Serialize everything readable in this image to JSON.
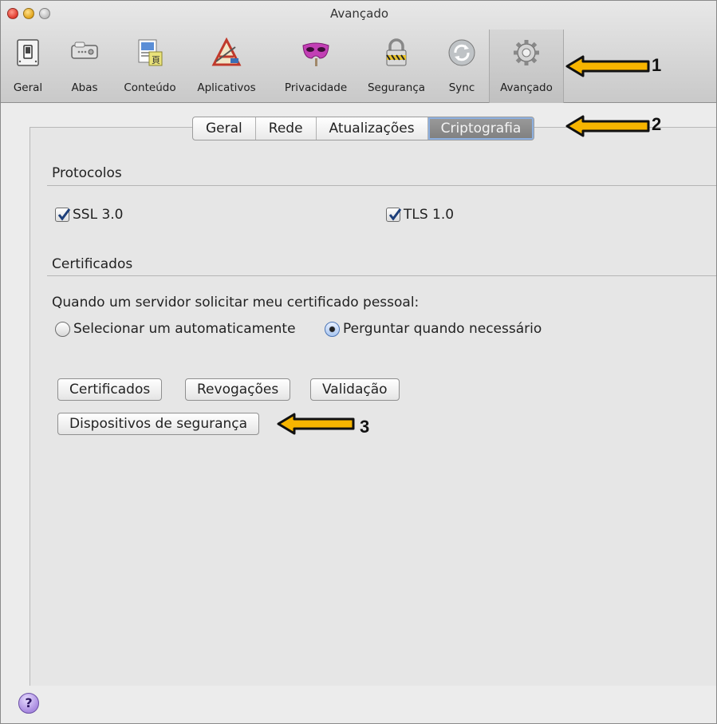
{
  "window": {
    "title": "Avançado"
  },
  "toolbar": {
    "items": [
      {
        "label": "Geral",
        "icon": "switch-icon"
      },
      {
        "label": "Abas",
        "icon": "tabs-icon"
      },
      {
        "label": "Conteúdo",
        "icon": "content-document-icon"
      },
      {
        "label": "Aplicativos",
        "icon": "applications-icon"
      },
      {
        "label": "Privacidade",
        "icon": "mask-icon"
      },
      {
        "label": "Segurança",
        "icon": "padlock-icon"
      },
      {
        "label": "Sync",
        "icon": "sync-icon"
      },
      {
        "label": "Avançado",
        "icon": "gear-icon"
      }
    ],
    "active": "Avançado"
  },
  "tabs": {
    "items": [
      "Geral",
      "Rede",
      "Atualizações",
      "Criptografia"
    ],
    "selected": "Criptografia"
  },
  "protocols": {
    "title": "Protocolos",
    "ssl": {
      "label": "SSL 3.0",
      "checked": true
    },
    "tls": {
      "label": "TLS 1.0",
      "checked": true
    }
  },
  "certificates": {
    "title": "Certificados",
    "prompt": "Quando um servidor solicitar meu certificado pessoal:",
    "radio_auto": {
      "label": "Selecionar um automaticamente",
      "selected": false
    },
    "radio_ask": {
      "label": "Perguntar quando necessário",
      "selected": true
    },
    "buttons": {
      "certificados": "Certificados",
      "revogacoes": "Revogações",
      "validacao": "Validação",
      "dispositivos": "Dispositivos de segurança"
    }
  },
  "help": {
    "label": "?"
  },
  "annotations": [
    "1",
    "2",
    "3"
  ],
  "colors": {
    "arrow_fill": "#f7b500",
    "arrow_stroke": "#111111",
    "selected_tab": "#8a8a8a",
    "help_button": "#a98ae0"
  }
}
